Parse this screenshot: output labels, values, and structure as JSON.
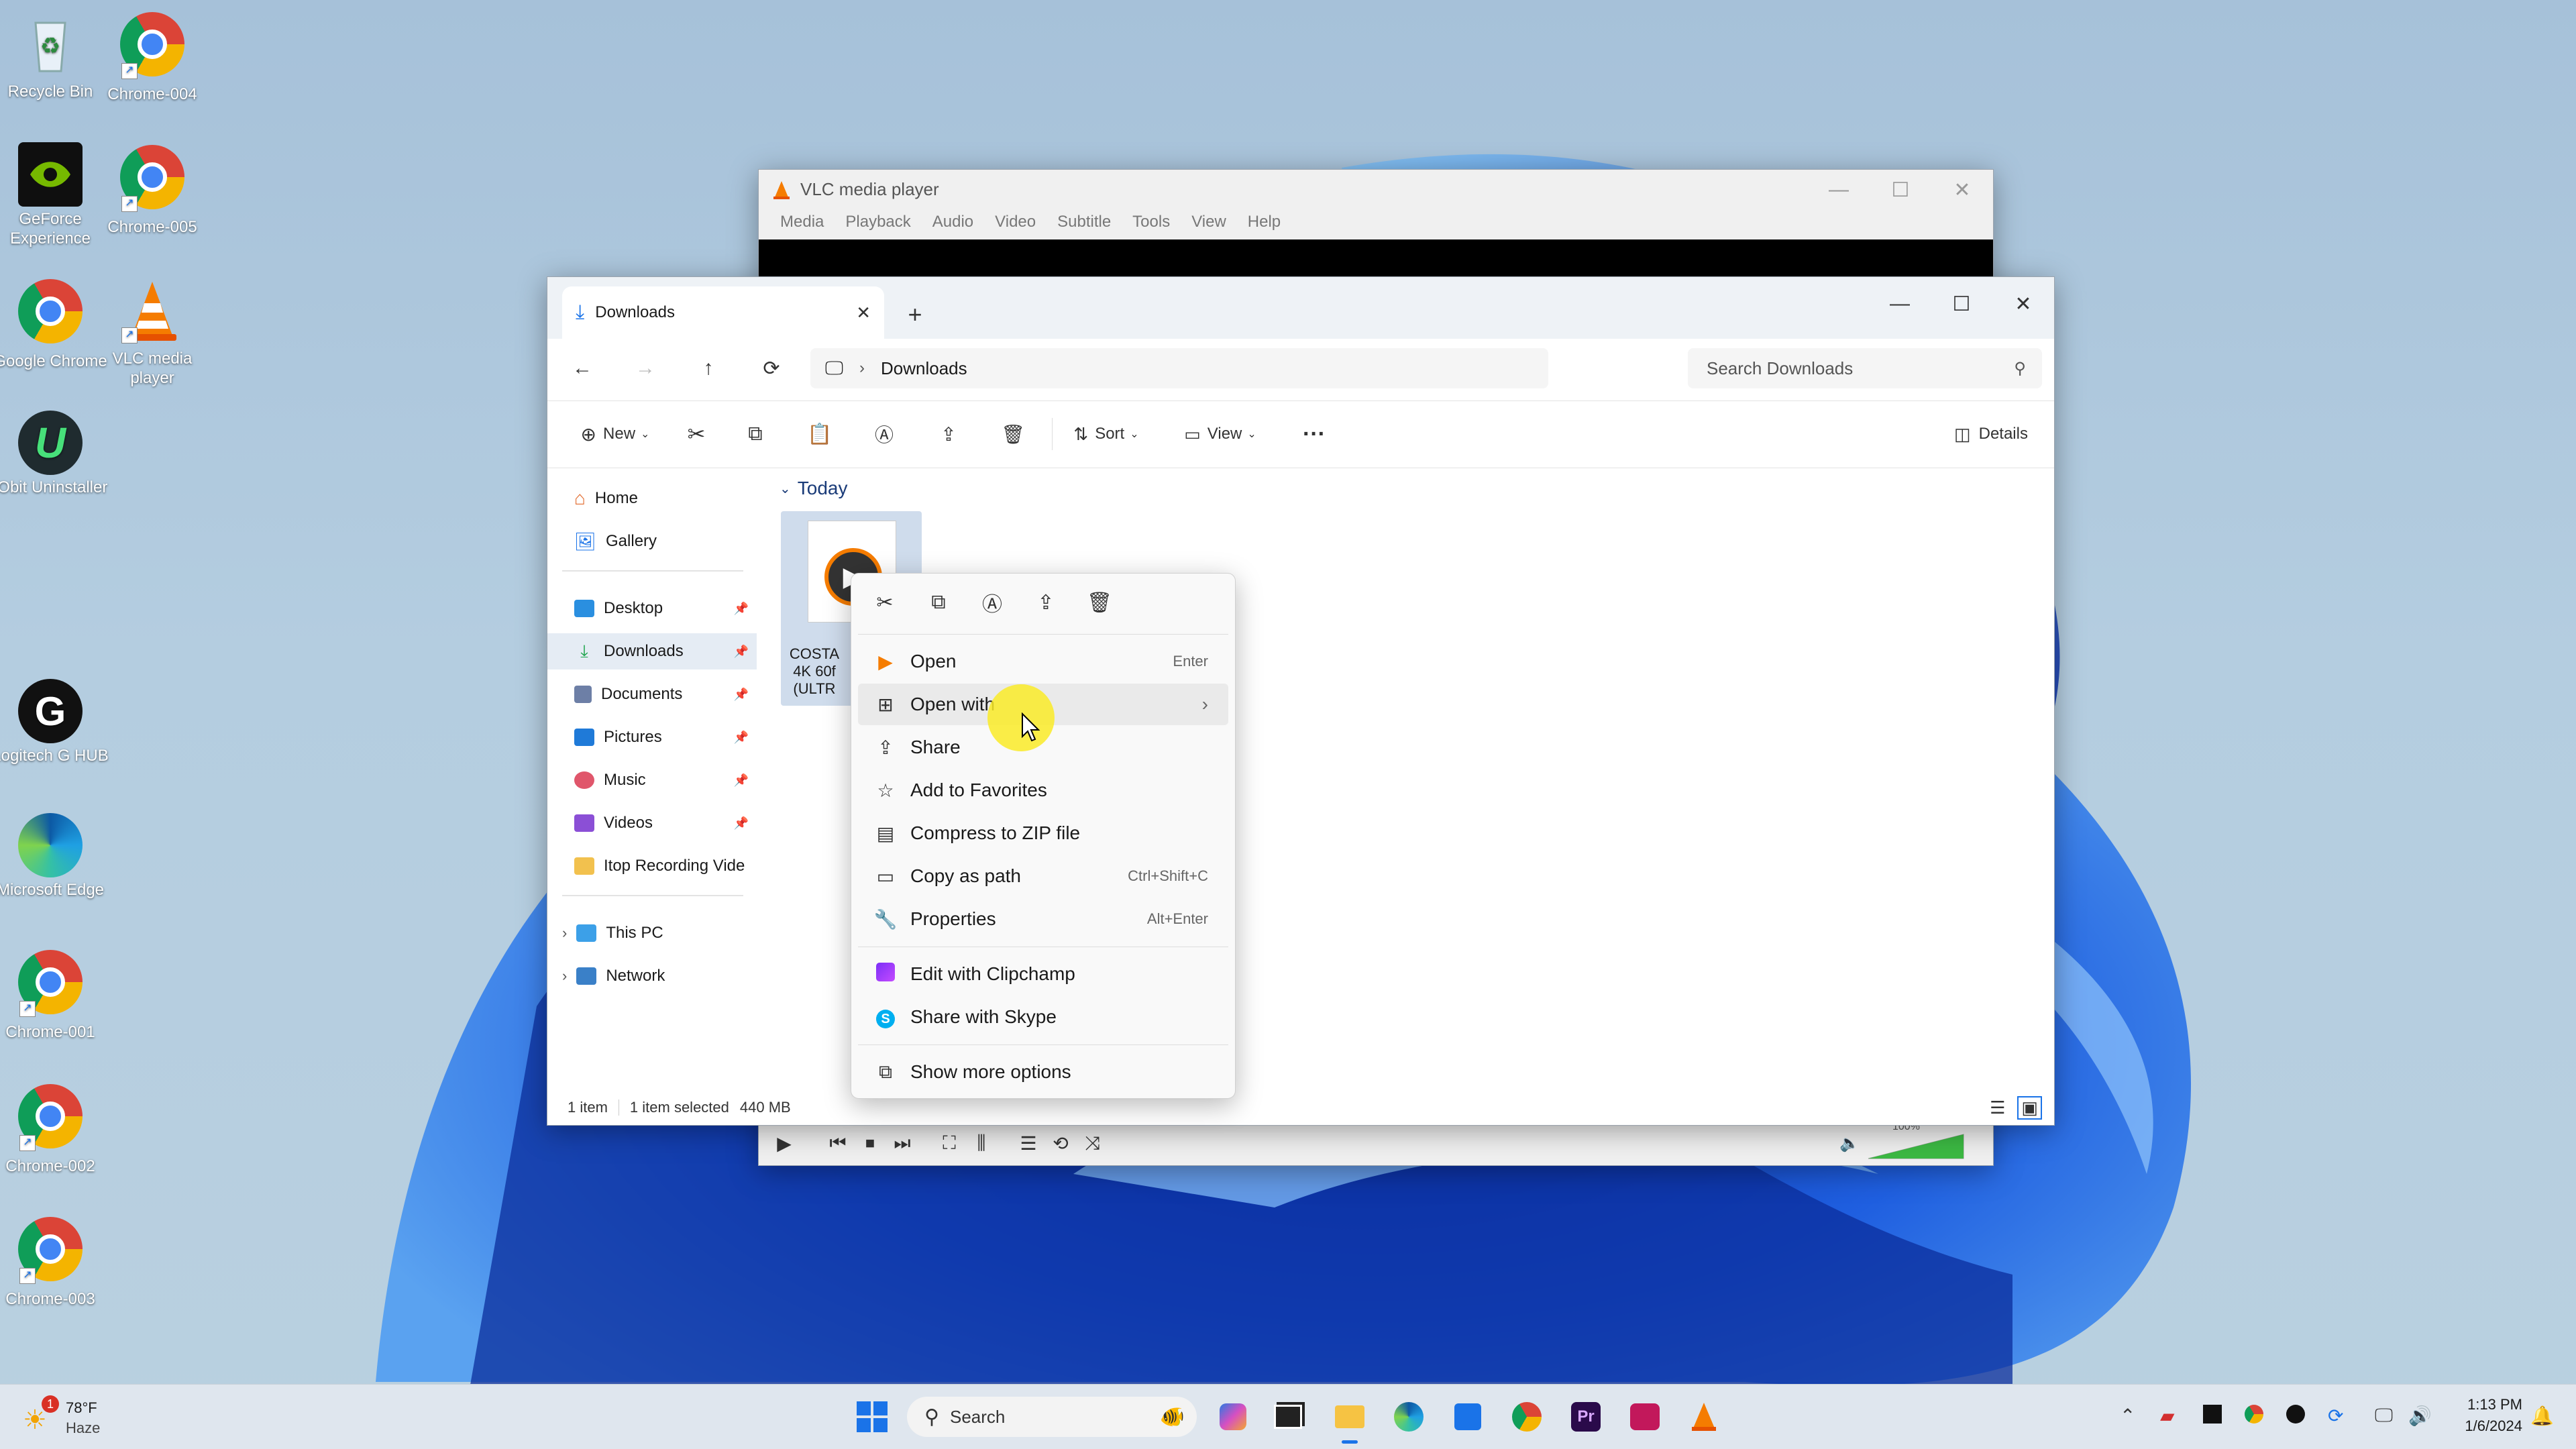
{
  "desktop": {
    "icons": [
      {
        "label": "Recycle Bin",
        "icon": "recycle-bin-icon"
      },
      {
        "label": "Chrome-004",
        "icon": "chrome-icon"
      },
      {
        "label": "GeForce Experience",
        "icon": "geforce-icon"
      },
      {
        "label": "Chrome-005",
        "icon": "chrome-icon"
      },
      {
        "label": "Google Chrome",
        "icon": "chrome-icon"
      },
      {
        "label": "VLC media player",
        "icon": "vlc-icon"
      },
      {
        "label": "IObit Uninstaller",
        "icon": "iobit-icon"
      },
      {
        "label": "Logitech G HUB",
        "icon": "logitech-icon"
      },
      {
        "label": "Microsoft Edge",
        "icon": "edge-icon"
      },
      {
        "label": "Chrome-001",
        "icon": "chrome-icon"
      },
      {
        "label": "Chrome-002",
        "icon": "chrome-icon"
      },
      {
        "label": "Chrome-003",
        "icon": "chrome-icon"
      }
    ]
  },
  "vlc": {
    "title": "VLC media player",
    "menu": [
      "Media",
      "Playback",
      "Audio",
      "Video",
      "Subtitle",
      "Tools",
      "View",
      "Help"
    ],
    "volume": "100%",
    "volume_level": 1.0
  },
  "explorer": {
    "tab_title": "Downloads",
    "breadcrumb": "Downloads",
    "search_placeholder": "Search Downloads",
    "toolbar": {
      "new": "New",
      "sort": "Sort",
      "view": "View",
      "details": "Details"
    },
    "nav": {
      "home": "Home",
      "gallery": "Gallery",
      "desktop": "Desktop",
      "downloads": "Downloads",
      "documents": "Documents",
      "pictures": "Pictures",
      "music": "Music",
      "videos": "Videos",
      "itop": "Itop Recording Vide",
      "thispc": "This PC",
      "network": "Network"
    },
    "group_header": "Today",
    "file": {
      "line1": "COSTA",
      "line2": "4K 60f",
      "line3": "(ULTR"
    },
    "status": {
      "count": "1 item",
      "selected": "1 item selected",
      "size": "440 MB"
    }
  },
  "context_menu": {
    "items": [
      {
        "label": "Open",
        "shortcut": "Enter"
      },
      {
        "label": "Open with",
        "shortcut": ""
      },
      {
        "label": "Share",
        "shortcut": ""
      },
      {
        "label": "Add to Favorites",
        "shortcut": ""
      },
      {
        "label": "Compress to ZIP file",
        "shortcut": ""
      },
      {
        "label": "Copy as path",
        "shortcut": "Ctrl+Shift+C"
      },
      {
        "label": "Properties",
        "shortcut": "Alt+Enter"
      },
      {
        "label": "Edit with Clipchamp",
        "shortcut": ""
      },
      {
        "label": "Share with Skype",
        "shortcut": ""
      },
      {
        "label": "Show more options",
        "shortcut": ""
      }
    ]
  },
  "taskbar": {
    "weather_temp": "78°F",
    "weather_desc": "Haze",
    "weather_badge": "1",
    "search_label": "Search",
    "time": "1:13 PM",
    "date": "1/6/2024"
  }
}
